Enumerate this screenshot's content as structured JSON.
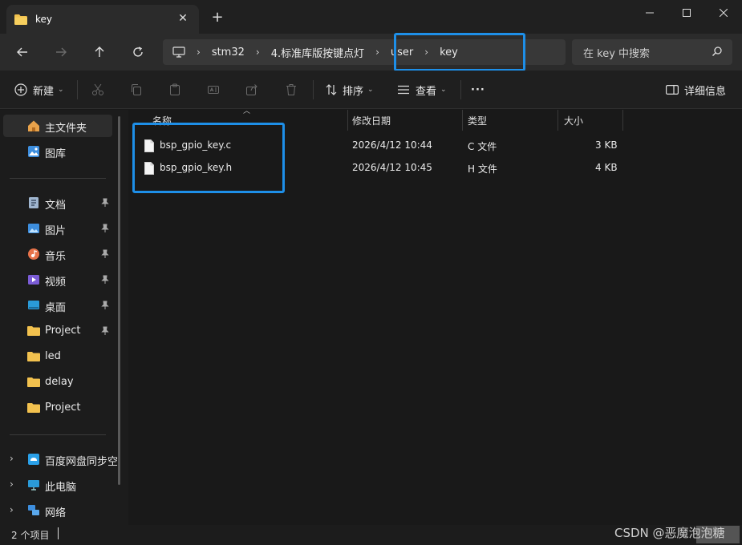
{
  "window": {
    "tab_title": "key",
    "new_tab_symbol": "+",
    "close_tab_symbol": "✕"
  },
  "nav": {
    "breadcrumbs": [
      "stm32",
      "4.标准库版按键点灯",
      "user",
      "key"
    ],
    "search_placeholder": "在 key 中搜索"
  },
  "toolbar": {
    "new_label": "新建",
    "sort_label": "排序",
    "view_label": "查看",
    "more_label": "···",
    "details_label": "详细信息"
  },
  "sidebar": {
    "top": [
      {
        "label": "主文件夹",
        "icon": "home-icon",
        "selected": true
      },
      {
        "label": "图库",
        "icon": "gallery-icon"
      }
    ],
    "pinned": [
      {
        "label": "文档",
        "icon": "documents-icon",
        "pinned": true
      },
      {
        "label": "图片",
        "icon": "pictures-icon",
        "pinned": true
      },
      {
        "label": "音乐",
        "icon": "music-icon",
        "pinned": true
      },
      {
        "label": "视频",
        "icon": "videos-icon",
        "pinned": true
      },
      {
        "label": "桌面",
        "icon": "desktop-icon",
        "pinned": true
      },
      {
        "label": "Project",
        "icon": "folder-icon",
        "pinned": true
      },
      {
        "label": "led",
        "icon": "folder-icon"
      },
      {
        "label": "delay",
        "icon": "folder-icon"
      },
      {
        "label": "Project",
        "icon": "folder-icon"
      }
    ],
    "bottom": [
      {
        "label": "百度网盘同步空",
        "icon": "baidu-cloud-icon"
      },
      {
        "label": "此电脑",
        "icon": "this-pc-icon"
      },
      {
        "label": "网络",
        "icon": "network-icon"
      }
    ]
  },
  "columns": [
    "名称",
    "修改日期",
    "类型",
    "大小"
  ],
  "files": [
    {
      "name": "bsp_gpio_key.c",
      "modified": "2026/4/12 10:44",
      "type": "C 文件",
      "size": "3 KB"
    },
    {
      "name": "bsp_gpio_key.h",
      "modified": "2026/4/12 10:45",
      "type": "H 文件",
      "size": "4 KB"
    }
  ],
  "status": {
    "item_count": "2 个项目"
  },
  "watermark": "CSDN @恶魔泡泡糖",
  "colors": {
    "accent": "#1e8fe8",
    "folder": "#f2c14e",
    "background": "#191919"
  }
}
